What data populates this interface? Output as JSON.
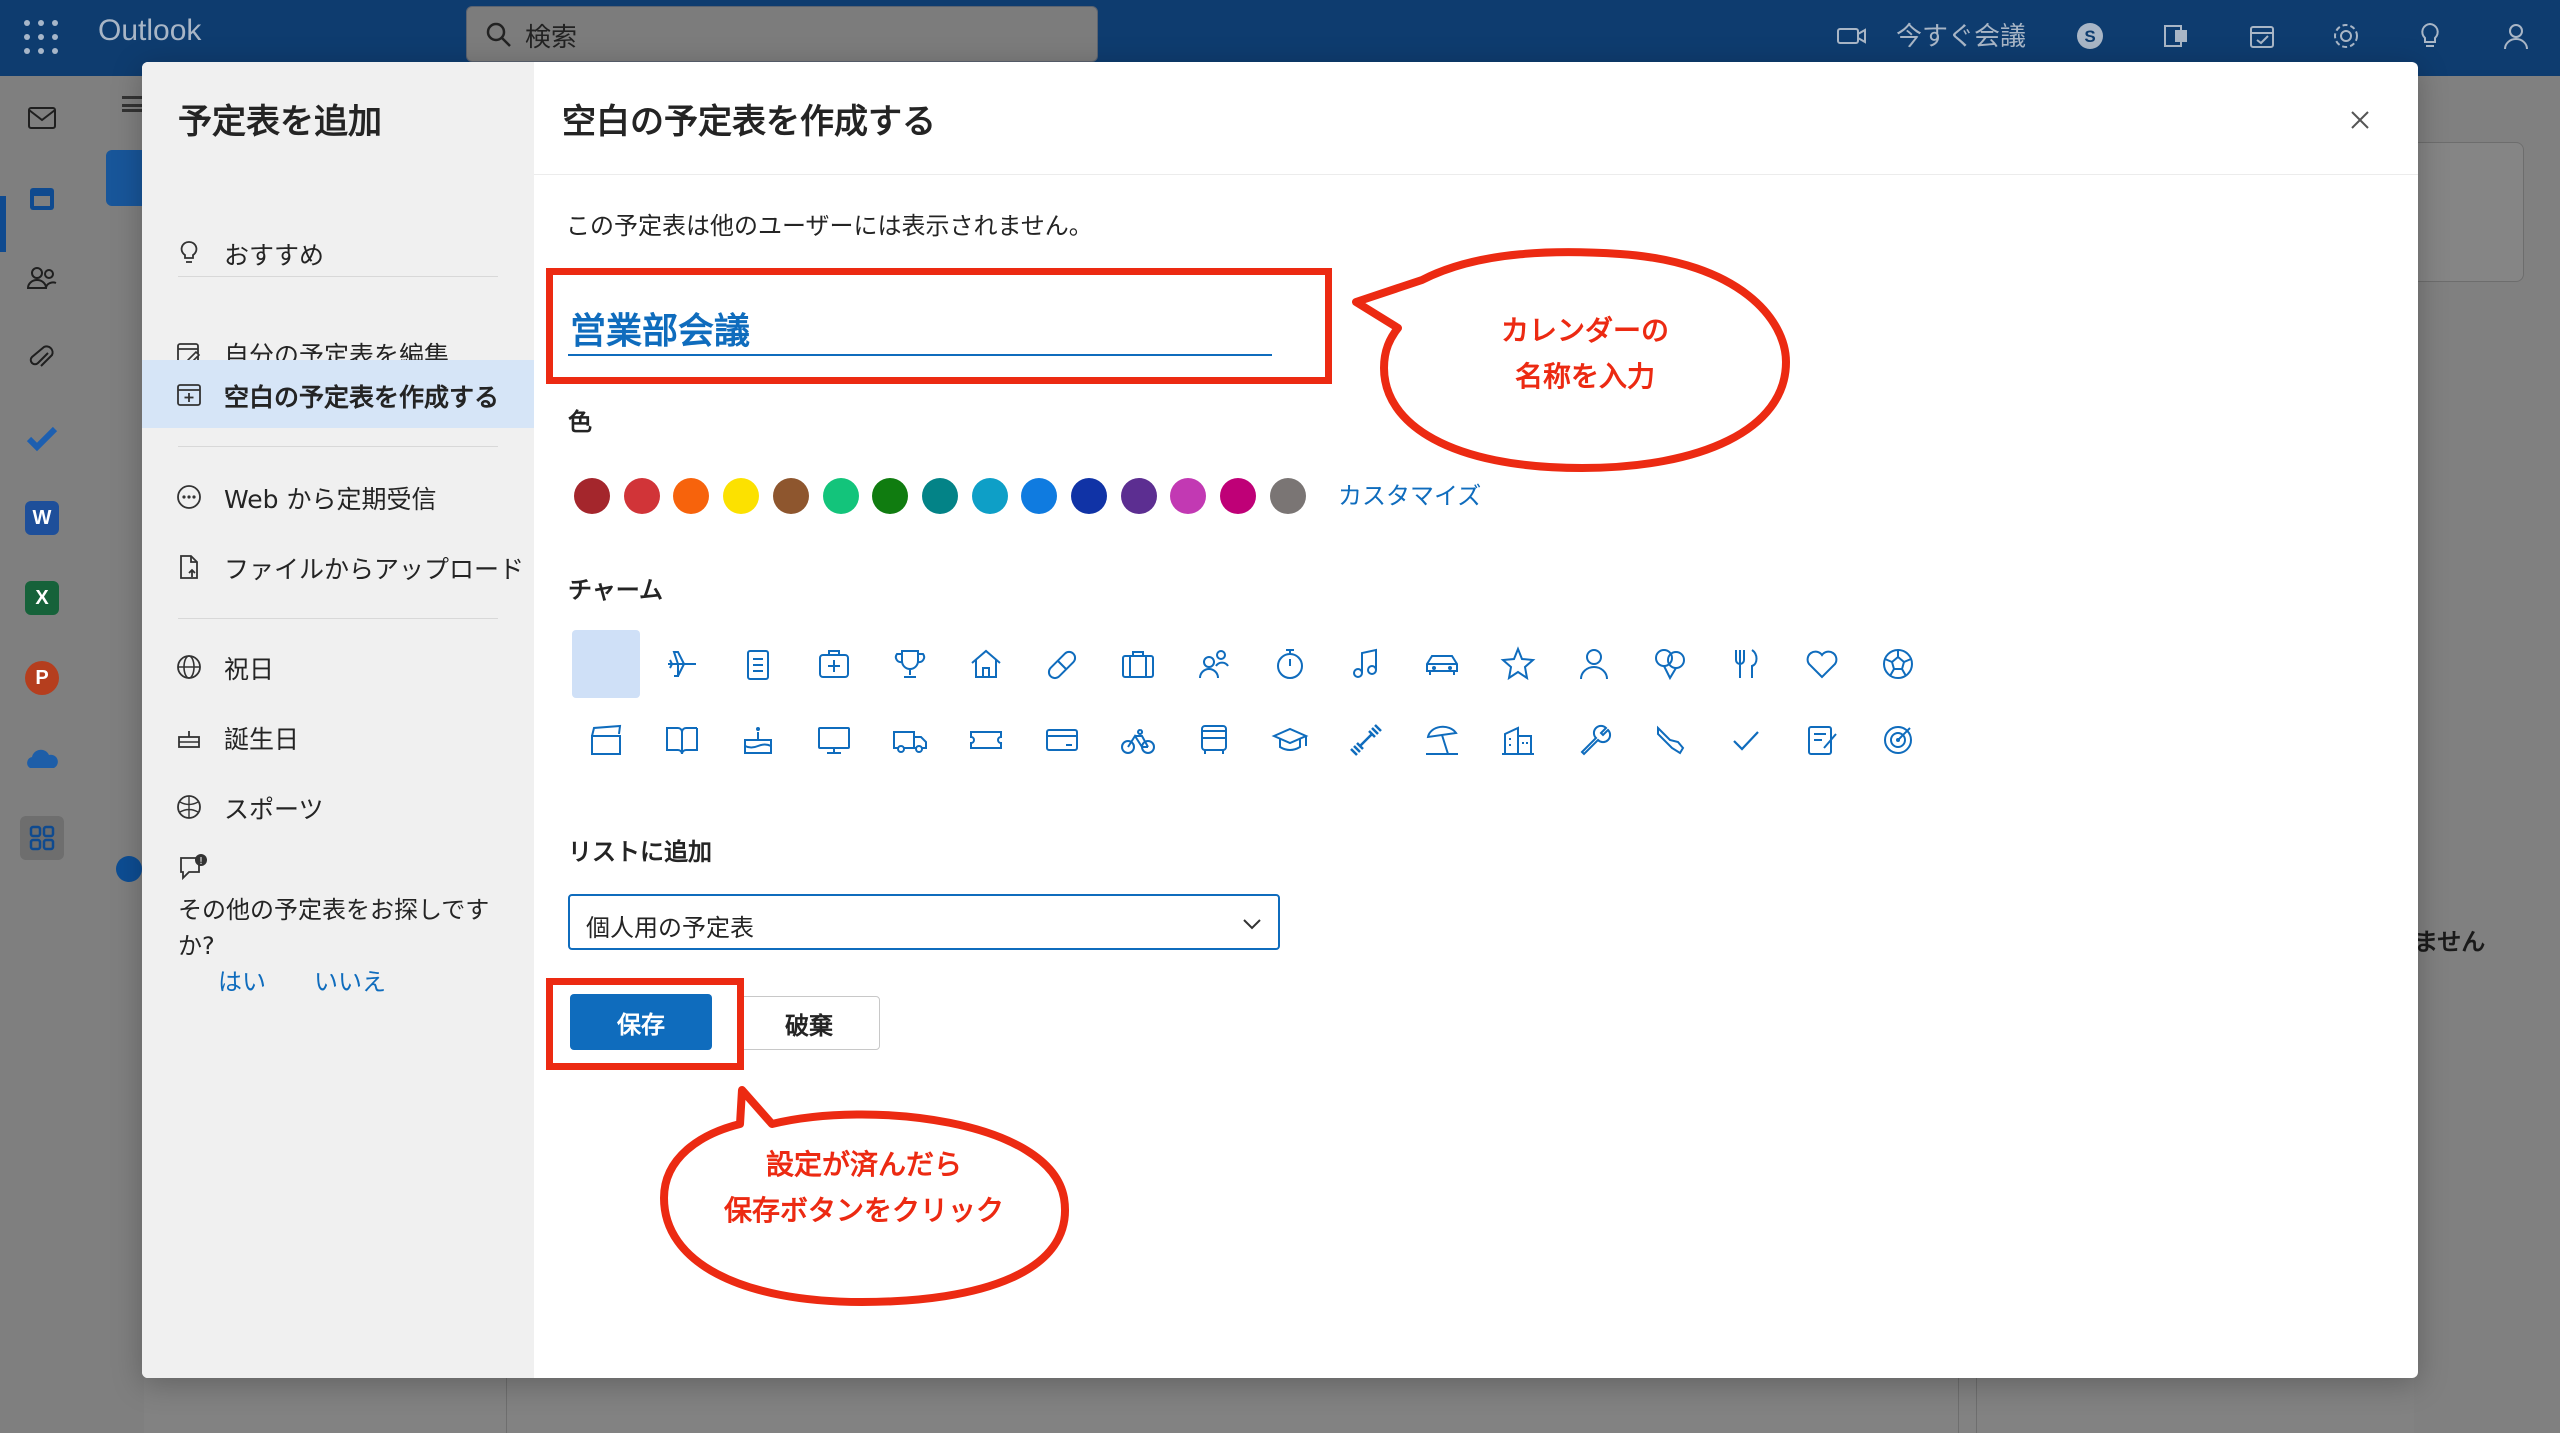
{
  "topbar": {
    "app_name": "Outlook",
    "search_placeholder": "検索",
    "meet_now": "今すぐ会議"
  },
  "dialog": {
    "side_title": "予定表を追加",
    "side_items": [
      {
        "label": "おすすめ",
        "icon": "lightbulb-icon"
      },
      {
        "label": "自分の予定表を編集",
        "icon": "edit-calendar-icon"
      },
      {
        "label": "空白の予定表を作成する",
        "icon": "calendar-add-icon",
        "active": true
      },
      {
        "label": "Web から定期受信",
        "icon": "more-circle-icon"
      },
      {
        "label": "ファイルからアップロード",
        "icon": "file-upload-icon"
      },
      {
        "label": "祝日",
        "icon": "globe-icon"
      },
      {
        "label": "誕生日",
        "icon": "cake-icon"
      },
      {
        "label": "スポーツ",
        "icon": "sports-ball-icon"
      }
    ],
    "side_question": "その他の予定表をお探しですか?",
    "side_yes": "はい",
    "side_no": "いいえ",
    "main_title": "空白の予定表を作成する",
    "notice": "この予定表は他のユーザーには表示されません。",
    "calendar_name": "営業部会議",
    "color_label": "色",
    "colors": [
      "#a4262c",
      "#d13438",
      "#f7630c",
      "#fce100",
      "#8e562e",
      "#13c47b",
      "#107c10",
      "#038387",
      "#0e9fc7",
      "#0f7be0",
      "#1033a6",
      "#5c2e91",
      "#c239b3",
      "#bf0077",
      "#7a7574"
    ],
    "customize_label": "カスタマイズ",
    "charm_label": "チャーム",
    "charms_row1": [
      "none",
      "airplane-icon",
      "clipboard-icon",
      "first-aid-icon",
      "trophy-icon",
      "home-icon",
      "pill-icon",
      "briefcase-icon",
      "people-icon",
      "stopwatch-icon",
      "music-note-icon",
      "car-icon",
      "star-icon",
      "person-icon",
      "balloon-icon",
      "fork-knife-icon",
      "heart-icon",
      "soccer-ball-icon"
    ],
    "charms_row2": [
      "clapperboard-icon",
      "book-icon",
      "cake-icon",
      "desktop-icon",
      "truck-icon",
      "ticket-icon",
      "credit-card-icon",
      "bicycle-icon",
      "bus-icon",
      "graduation-cap-icon",
      "dumbbell-icon",
      "beach-umbrella-icon",
      "building-icon",
      "wrench-icon",
      "shoe-icon",
      "checkmark-icon",
      "notepad-icon",
      "target-icon"
    ],
    "list_label": "リストに追加",
    "list_value": "個人用の予定表",
    "save_label": "保存",
    "discard_label": "破棄"
  },
  "annotations": {
    "callout1": [
      "カレンダーの",
      "名称を入力"
    ],
    "callout2": [
      "設定が済んだら",
      "保存ボタンをクリック"
    ],
    "highlight_color": "#ec2a12"
  },
  "background": {
    "right_text": "ません"
  }
}
